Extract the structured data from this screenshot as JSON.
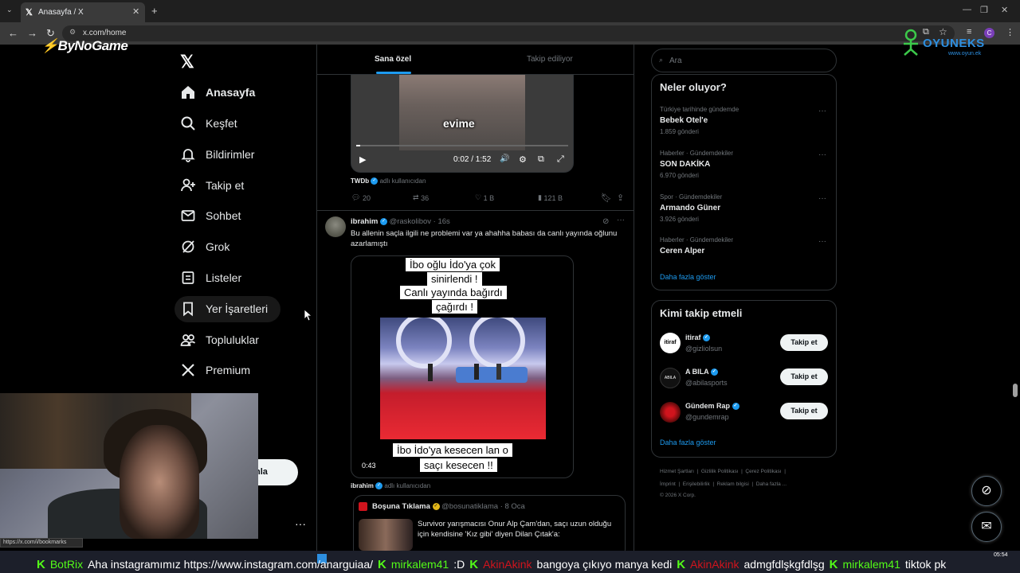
{
  "browser": {
    "tab_title": "Anasayfa / X",
    "url": "x.com/home",
    "status_url": "https://x.com/i/bookmarks"
  },
  "overlay": {
    "bynogame": "ByNoGame",
    "oyun_logo": "OYUNEKS",
    "oyun_sub": "www.oyun.ek"
  },
  "sidebar": {
    "items": [
      {
        "label": "Anasayfa",
        "icon": "home-icon"
      },
      {
        "label": "Keşfet",
        "icon": "search-icon"
      },
      {
        "label": "Bildirimler",
        "icon": "bell-icon"
      },
      {
        "label": "Takip et",
        "icon": "person-plus-icon"
      },
      {
        "label": "Sohbet",
        "icon": "mail-icon"
      },
      {
        "label": "Grok",
        "icon": "grok-icon"
      },
      {
        "label": "Listeler",
        "icon": "list-icon"
      },
      {
        "label": "Yer İşaretleri",
        "icon": "bookmark-icon"
      },
      {
        "label": "Topluluklar",
        "icon": "people-icon"
      },
      {
        "label": "Premium",
        "icon": "x-icon"
      }
    ],
    "post_button_partial": "nla"
  },
  "main": {
    "tabs": [
      "Sana özel",
      "Takip ediliyor"
    ],
    "post1": {
      "video_caption": "evime",
      "video_time": "0:02 / 1:52",
      "source_name": "TWDb",
      "source_suffix": "adlı kullanıcıdan",
      "replies": "20",
      "reposts": "36",
      "likes": "1 B",
      "views": "121 B"
    },
    "post2": {
      "name": "ibrahim",
      "handle": "@raskolibov",
      "time": "16s",
      "text": "Bu allenin saçla ilgili ne problemi var ya ahahha babası da canlı yayında oğlunu azarlamıştı",
      "caption_top_lines": [
        "İbo oğlu İdo'ya çok",
        "sinirlendi !",
        "Canlı yayında bağırdı",
        "çağırdı !"
      ],
      "caption_bottom_lines": [
        "İbo İdo'ya kesecen lan o",
        "saçı kesecen !!"
      ],
      "video_time": "0:43",
      "source_name": "ibrahim",
      "source_suffix": "adlı kullanıcıdan"
    },
    "quote": {
      "name": "Boşuna Tıklama",
      "handle": "@bosunatiklama",
      "time": "8 Oca",
      "text": "Survivor yarışmacısı Onur Alp Çam'dan, saçı uzun olduğu için kendisine 'Kız gibi' diyen Dilan Çıtak'a:"
    }
  },
  "right": {
    "search_placeholder": "Ara",
    "trends_title": "Neler oluyor?",
    "trends": [
      {
        "category": "Türkiye tarihinde gündemde",
        "name": "Bebek Otel'e",
        "count": "1.859 gönderi"
      },
      {
        "category": "Haberler · Gündemdekiler",
        "name": "SON DAKİKA",
        "count": "6.970 gönderi"
      },
      {
        "category": "Spor · Gündemdekiler",
        "name": "Armando Güner",
        "count": "3.926 gönderi"
      },
      {
        "category": "Haberler · Gündemdekiler",
        "name": "Ceren Alper",
        "count": ""
      }
    ],
    "show_more": "Daha fazla göster",
    "follow_title": "Kimi takip etmeli",
    "follow": [
      {
        "name": "itiraf",
        "handle": "@gizliolsun",
        "button": "Takip et"
      },
      {
        "name": "A BILA",
        "handle": "@abilasports",
        "button": "Takip et"
      },
      {
        "name": "Gündem Rap",
        "handle": "@gundemrap",
        "button": "Takip et"
      }
    ],
    "footer_line1": [
      "Hizmet Şartları",
      "Gizlilik Politikası",
      "Çerez Politikası"
    ],
    "footer_line2": [
      "İmprint",
      "Erişilebilirlik",
      "Reklam bilgisi",
      "Daha fazla ..."
    ],
    "copyright": "© 2026 X Corp."
  },
  "chat": [
    {
      "name": "BotRix",
      "color": "green",
      "msg": "Aha instagramımız https://www.instagram.com/anarguiaa/"
    },
    {
      "name": "mirkalem41",
      "color": "green",
      "msg": ":D"
    },
    {
      "name": "AkinAkink",
      "color": "red",
      "msg": "bangoya çıkıyo manya kedi"
    },
    {
      "name": "AkinAkink",
      "color": "red",
      "msg": "admgfdlşkgfdlşg"
    },
    {
      "name": "mirkalem41",
      "color": "green",
      "msg": "tiktok pk"
    }
  ],
  "clock": {
    "time": "05:54"
  }
}
